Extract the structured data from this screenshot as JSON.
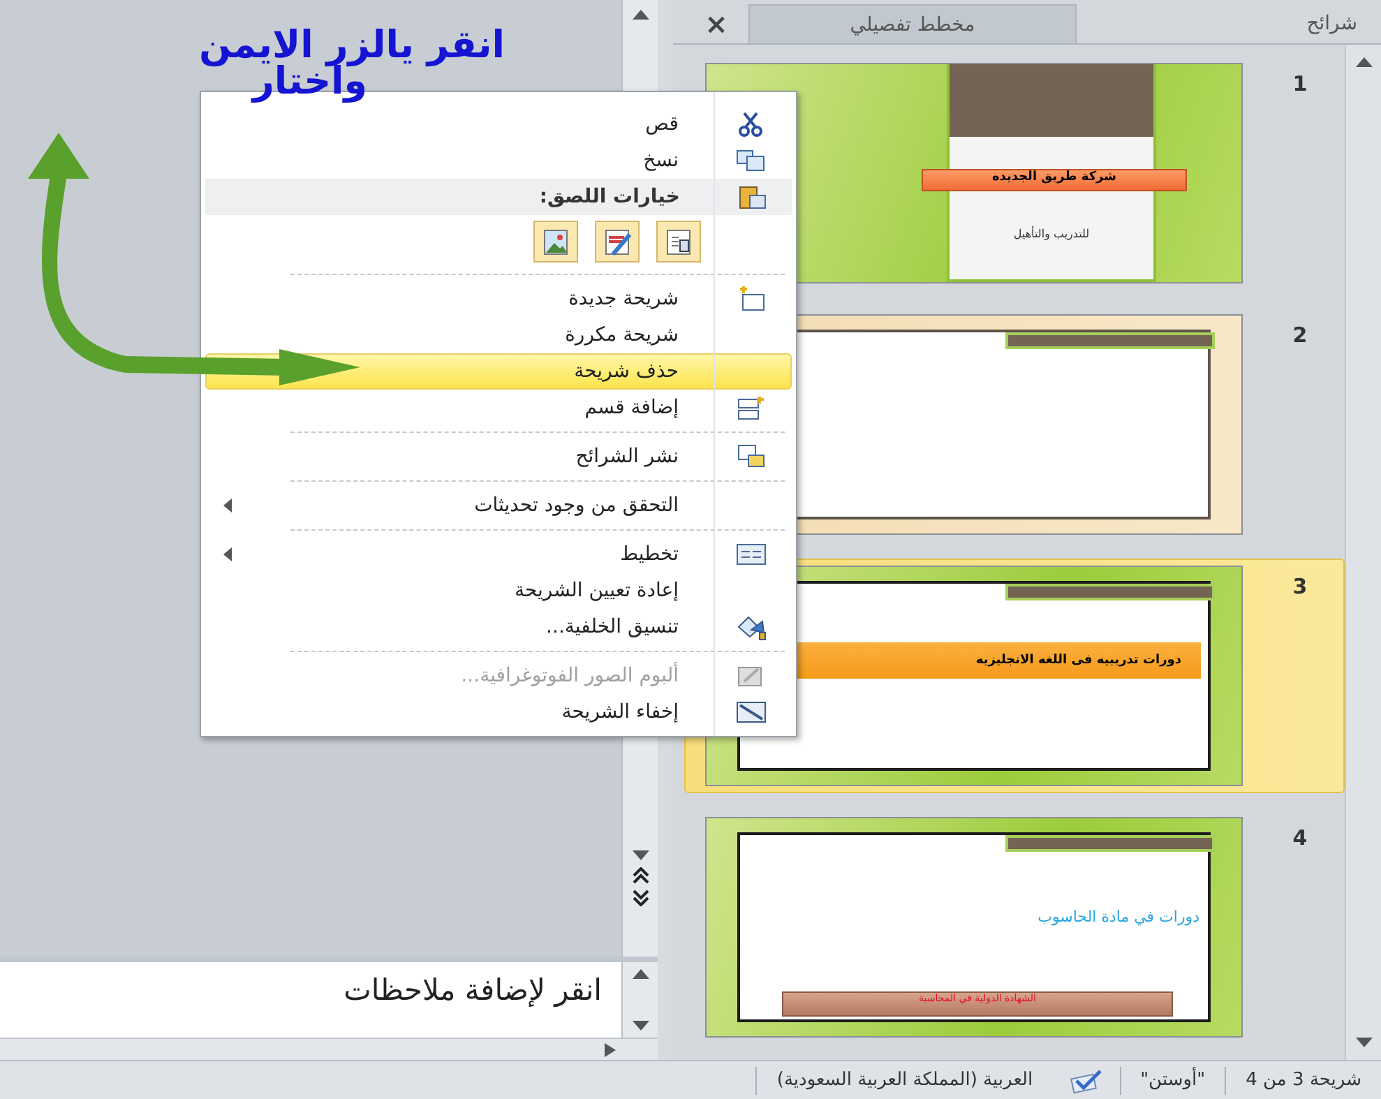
{
  "annotation": {
    "lines": [
      "انقر يالزر الايمن",
      "واختار"
    ]
  },
  "context_menu": {
    "items": [
      {
        "kind": "command",
        "label": "قص",
        "selected": false,
        "disabled": false,
        "submenu": false
      },
      {
        "kind": "command",
        "label": "نسخ",
        "selected": false,
        "disabled": false,
        "submenu": false
      },
      {
        "kind": "header",
        "label": "خيارات اللصق:"
      },
      {
        "kind": "paste_options"
      },
      {
        "kind": "separator"
      },
      {
        "kind": "command",
        "label": "شريحة جديدة",
        "selected": false,
        "disabled": false,
        "submenu": false
      },
      {
        "kind": "command",
        "label": "شريحة مكررة",
        "selected": false,
        "disabled": false,
        "submenu": false
      },
      {
        "kind": "command",
        "label": "حذف شريحة",
        "selected": true,
        "disabled": false,
        "submenu": false
      },
      {
        "kind": "command",
        "label": "إضافة قسم",
        "selected": false,
        "disabled": false,
        "submenu": false
      },
      {
        "kind": "separator"
      },
      {
        "kind": "command",
        "label": "نشر الشرائح",
        "selected": false,
        "disabled": false,
        "submenu": false
      },
      {
        "kind": "separator"
      },
      {
        "kind": "command",
        "label": "التحقق من وجود تحديثات",
        "selected": false,
        "disabled": false,
        "submenu": true
      },
      {
        "kind": "separator"
      },
      {
        "kind": "command",
        "label": "تخطيط",
        "selected": false,
        "disabled": false,
        "submenu": true
      },
      {
        "kind": "command",
        "label": "إعادة تعيين الشريحة",
        "selected": false,
        "disabled": false,
        "submenu": false
      },
      {
        "kind": "command",
        "label": "تنسيق الخلفية...",
        "selected": false,
        "disabled": false,
        "submenu": false
      },
      {
        "kind": "separator"
      },
      {
        "kind": "command",
        "label": "ألبوم الصور الفوتوغرافية...",
        "selected": false,
        "disabled": true,
        "submenu": false
      },
      {
        "kind": "command",
        "label": "إخفاء الشريحة",
        "selected": false,
        "disabled": false,
        "submenu": false
      }
    ]
  },
  "notes": {
    "placeholder": "انقر لإضافة ملاحظات"
  },
  "panel": {
    "tabs": [
      {
        "label": "شرائح",
        "selected": true
      },
      {
        "label": "مخطط تفصيلي",
        "selected": false
      }
    ],
    "close": "×"
  },
  "slides": [
    {
      "number": "1",
      "selected": false,
      "kind": "title",
      "title": "شركة طريق الجديده",
      "subtitle": "للتدريب والتأهيل"
    },
    {
      "number": "2",
      "selected": false,
      "kind": "blank"
    },
    {
      "number": "3",
      "selected": true,
      "kind": "content",
      "title": "دورات تدريبيه فى اللغه الانجليزيه"
    },
    {
      "number": "4",
      "selected": false,
      "kind": "content2",
      "title": "دورات في مادة الحاسوب",
      "subtitle": "الشهادة الدولية في المحاسبة"
    }
  ],
  "status_bar": {
    "slide": "شريحة 3 من 4",
    "theme": "\"أوستن\"",
    "language": "العربية (المملكة العربية السعودية)"
  }
}
